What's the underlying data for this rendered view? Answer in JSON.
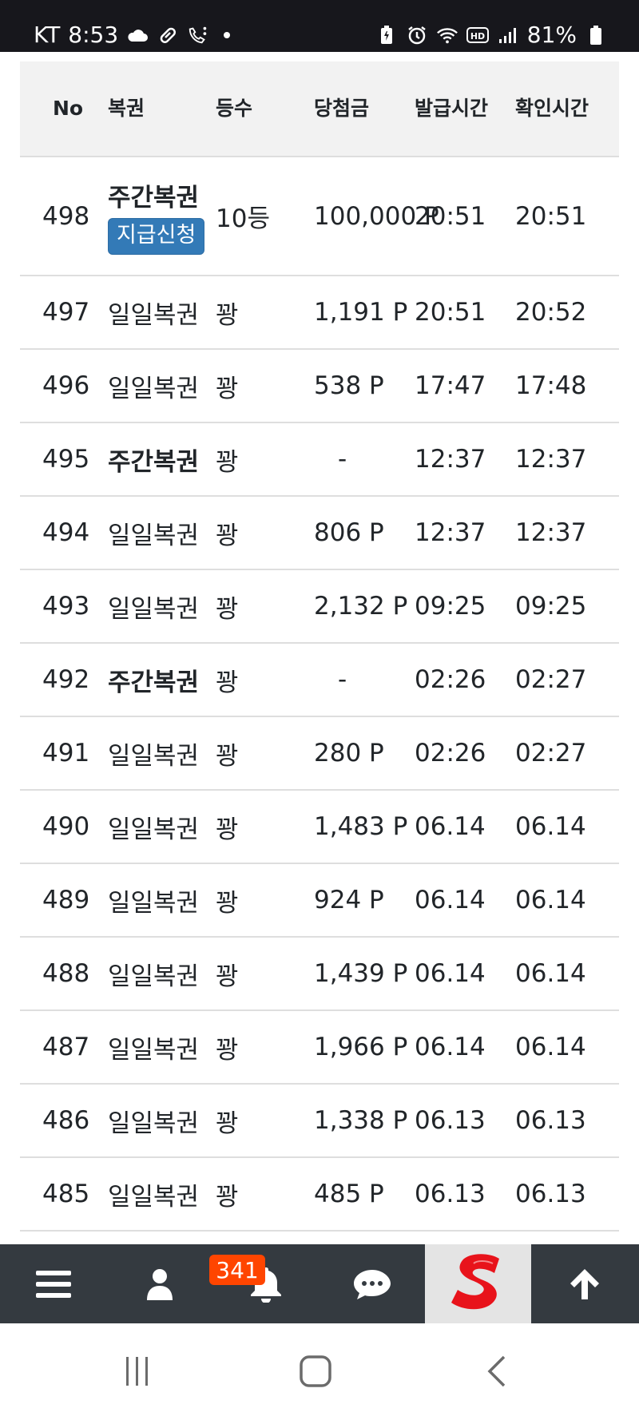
{
  "status_bar": {
    "carrier": "KT",
    "time": "8:53",
    "battery": "81%"
  },
  "table": {
    "headers": {
      "no": "No",
      "type": "복권",
      "rank": "등수",
      "prize": "당첨금",
      "issue_time": "발급시간",
      "check_time": "확인시간"
    },
    "rows": [
      {
        "no": "498",
        "type": "주간복권",
        "weekly": true,
        "button": "지급신청",
        "rank": "10등",
        "prize": "100,000 P",
        "issue": "20:51",
        "check": "20:51"
      },
      {
        "no": "497",
        "type": "일일복권",
        "weekly": false,
        "rank": "꽝",
        "prize": "1,191 P",
        "issue": "20:51",
        "check": "20:52"
      },
      {
        "no": "496",
        "type": "일일복권",
        "weekly": false,
        "rank": "꽝",
        "prize": "538 P",
        "issue": "17:47",
        "check": "17:48"
      },
      {
        "no": "495",
        "type": "주간복권",
        "weekly": true,
        "rank": "꽝",
        "prize": "-",
        "issue": "12:37",
        "check": "12:37"
      },
      {
        "no": "494",
        "type": "일일복권",
        "weekly": false,
        "rank": "꽝",
        "prize": "806 P",
        "issue": "12:37",
        "check": "12:37"
      },
      {
        "no": "493",
        "type": "일일복권",
        "weekly": false,
        "rank": "꽝",
        "prize": "2,132 P",
        "issue": "09:25",
        "check": "09:25"
      },
      {
        "no": "492",
        "type": "주간복권",
        "weekly": true,
        "rank": "꽝",
        "prize": "-",
        "issue": "02:26",
        "check": "02:27"
      },
      {
        "no": "491",
        "type": "일일복권",
        "weekly": false,
        "rank": "꽝",
        "prize": "280 P",
        "issue": "02:26",
        "check": "02:27"
      },
      {
        "no": "490",
        "type": "일일복권",
        "weekly": false,
        "rank": "꽝",
        "prize": "1,483 P",
        "issue": "06.14",
        "check": "06.14"
      },
      {
        "no": "489",
        "type": "일일복권",
        "weekly": false,
        "rank": "꽝",
        "prize": "924 P",
        "issue": "06.14",
        "check": "06.14"
      },
      {
        "no": "488",
        "type": "일일복권",
        "weekly": false,
        "rank": "꽝",
        "prize": "1,439 P",
        "issue": "06.14",
        "check": "06.14"
      },
      {
        "no": "487",
        "type": "일일복권",
        "weekly": false,
        "rank": "꽝",
        "prize": "1,966 P",
        "issue": "06.14",
        "check": "06.14"
      },
      {
        "no": "486",
        "type": "일일복권",
        "weekly": false,
        "rank": "꽝",
        "prize": "1,338 P",
        "issue": "06.13",
        "check": "06.13"
      },
      {
        "no": "485",
        "type": "일일복권",
        "weekly": false,
        "rank": "꽝",
        "prize": "485 P",
        "issue": "06.13",
        "check": "06.13"
      }
    ]
  },
  "bottom_nav": {
    "notification_count": "341",
    "items": [
      "menu-icon",
      "user-icon",
      "bell-icon",
      "chat-icon",
      "site-logo",
      "arrow-up-icon"
    ]
  },
  "colors": {
    "status_bar_bg": "#17171c",
    "header_bg": "#f2f2f2",
    "button_blue": "#337ab7",
    "nav_bg": "#343a40",
    "badge": "#ff4500",
    "logo_red": "#e8131b"
  }
}
